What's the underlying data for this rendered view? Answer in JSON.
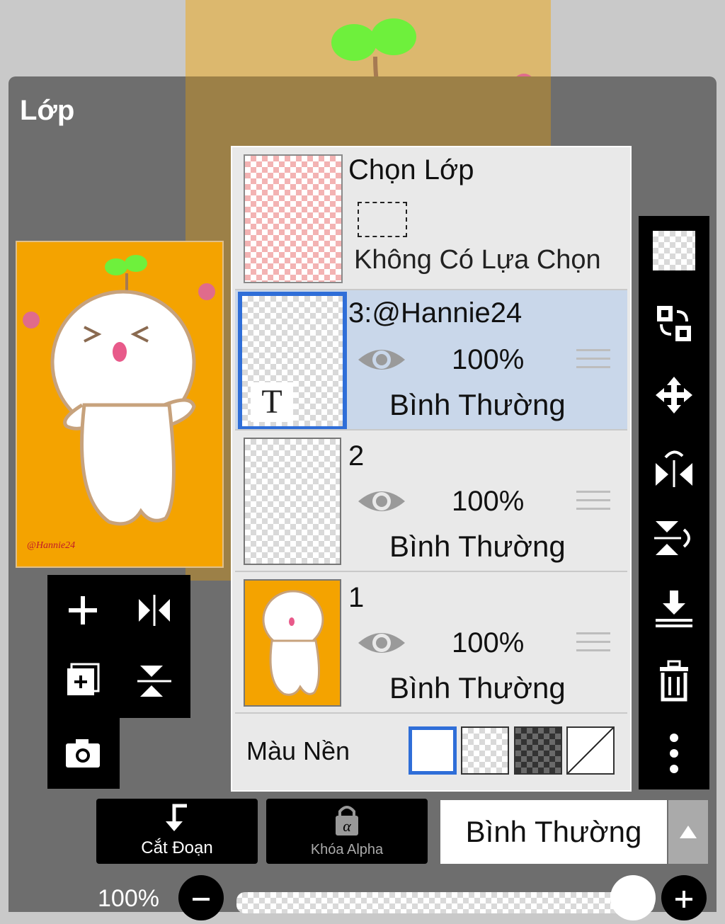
{
  "panel": {
    "title": "Lớp"
  },
  "selection": {
    "title": "Chọn Lớp",
    "subtitle": "Không Có Lựa Chọn"
  },
  "layers": [
    {
      "name": "3:@Hannie24",
      "opacity": "100%",
      "blend": "Bình Thường",
      "thumb_badge": "T"
    },
    {
      "name": "2",
      "opacity": "100%",
      "blend": "Bình Thường"
    },
    {
      "name": "1",
      "opacity": "100%",
      "blend": "Bình Thường"
    }
  ],
  "background": {
    "label": "Màu Nền"
  },
  "bottom": {
    "clip_label": "Cắt Đoạn",
    "alpha_label": "Khóa Alpha",
    "blend_mode": "Bình Thường"
  },
  "slider": {
    "value_label": "100%",
    "value": 1.0
  },
  "icons": {
    "right_toolbar": [
      "transparency-icon",
      "swap-layer-icon",
      "move-icon",
      "flip-horizontal-icon",
      "flip-vertical-icon",
      "merge-down-icon",
      "trash-icon",
      "more-icon"
    ],
    "left_tools": [
      "add-layer-icon",
      "flip-h-icon",
      "add-copy-icon",
      "flip-v-icon",
      "camera-icon"
    ]
  },
  "colors": {
    "accent": "#2f6ed8",
    "canvas_orange": "#f4a300",
    "active_row": "#c9d7ea"
  }
}
